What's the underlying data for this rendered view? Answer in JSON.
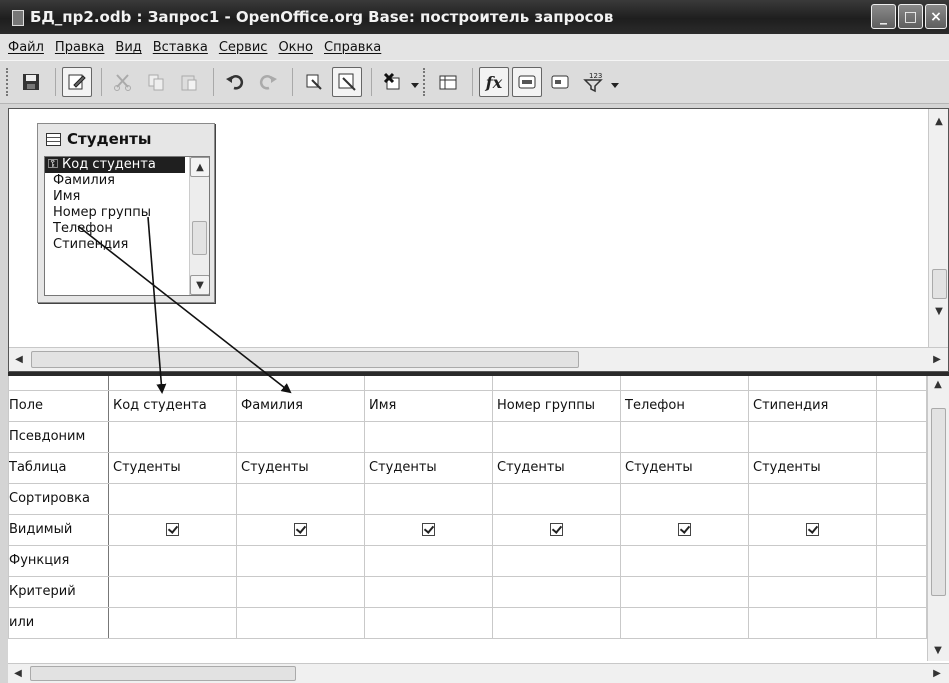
{
  "window": {
    "title": "БД_пр2.odb : Запрос1 - OpenOffice.org Base: построитель запросов",
    "minimize": "_",
    "maximize": "□",
    "close": "×"
  },
  "menu": [
    "Файл",
    "Правка",
    "Вид",
    "Вставка",
    "Сервис",
    "Окно",
    "Справка"
  ],
  "toolbar": {
    "save_icon": "floppy-disk-icon",
    "edit_icon": "edit-mode-icon",
    "cut_icon": "cut-icon",
    "copy_icon": "copy-icon",
    "paste_icon": "paste-icon",
    "undo_icon": "undo-icon",
    "redo_icon": "redo-icon",
    "fx_label": "fx"
  },
  "design": {
    "table": {
      "name": "Студенты",
      "fields": [
        "Код студента",
        "Фамилия",
        "Имя",
        "Номер группы",
        "Телефон",
        "Стипендия"
      ],
      "key_marker": "⚿"
    }
  },
  "grid": {
    "row_labels": [
      "Поле",
      "Псевдоним",
      "Таблица",
      "Сортировка",
      "Видимый",
      "Функция",
      "Критерий",
      "или"
    ],
    "columns": [
      {
        "field": "Код студента",
        "table": "Студенты",
        "visible": true
      },
      {
        "field": "Фамилия",
        "table": "Студенты",
        "visible": true
      },
      {
        "field": "Имя",
        "table": "Студенты",
        "visible": true
      },
      {
        "field": "Номер группы",
        "table": "Студенты",
        "visible": true
      },
      {
        "field": "Телефон",
        "table": "Студенты",
        "visible": true
      },
      {
        "field": "Стипендия",
        "table": "Студенты",
        "visible": true
      }
    ]
  },
  "scroll": {
    "up": "▲",
    "down": "▼",
    "left": "◀",
    "right": "▶"
  }
}
